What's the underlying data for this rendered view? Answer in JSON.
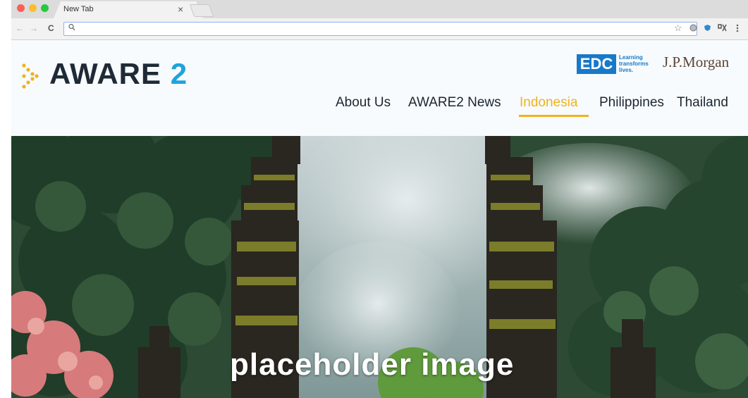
{
  "browser": {
    "tab_title": "New Tab",
    "tab_close": "×",
    "back": "←",
    "forward": "→",
    "reload": "C",
    "address_value": "",
    "star": "☆"
  },
  "site": {
    "logo_word": "AWARE",
    "logo_number": "2",
    "partner_edc": "EDC",
    "partner_edc_tagline": [
      "Learning",
      "transforms",
      "lives."
    ],
    "partner_jpm": "J.P.Morgan",
    "nav": [
      {
        "label": "About Us",
        "active": false
      },
      {
        "label": "AWARE2 News",
        "active": false
      },
      {
        "label": "Indonesia",
        "active": true
      },
      {
        "label": "Philippines",
        "active": false
      },
      {
        "label": "Thailand",
        "active": false
      }
    ],
    "accent_color": "#f0b21c",
    "brand_blue": "#1fa3dc"
  },
  "hero": {
    "caption": "placeholder image"
  }
}
